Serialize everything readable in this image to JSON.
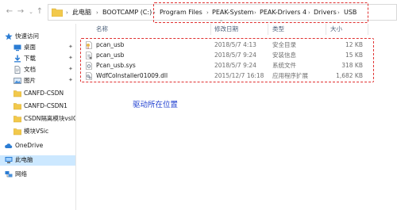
{
  "nav": {
    "back_icon": "arrow-left-icon",
    "forward_icon": "arrow-right-icon",
    "recent_icon": "chevron-down-icon",
    "up_icon": "arrow-up-icon"
  },
  "address": {
    "crumbs": [
      "此电脑",
      "BOOTCAMP (C:)",
      "Program Files",
      "PEAK-System",
      "PEAK-Drivers 4",
      "Drivers",
      "USB"
    ],
    "separator": "›"
  },
  "sidebar": {
    "items": [
      {
        "label": "快速访问",
        "icon": "star-icon",
        "pinned": false
      },
      {
        "label": "桌面",
        "icon": "desktop-icon",
        "pinned": true
      },
      {
        "label": "下载",
        "icon": "download-icon",
        "pinned": true
      },
      {
        "label": "文档",
        "icon": "document-icon",
        "pinned": true
      },
      {
        "label": "图片",
        "icon": "picture-icon",
        "pinned": true
      },
      {
        "label": "CANFD-CSDN",
        "icon": "folder-icon",
        "pinned": false
      },
      {
        "label": "CANFD-CSDN1",
        "icon": "folder-icon",
        "pinned": false
      },
      {
        "label": "CSDN隔离模块vsIC",
        "icon": "folder-icon",
        "pinned": false
      },
      {
        "label": "模块VSic",
        "icon": "folder-icon",
        "pinned": false
      },
      {
        "label": "OneDrive",
        "icon": "cloud-icon",
        "pinned": false
      },
      {
        "label": "此电脑",
        "icon": "computer-icon",
        "pinned": false,
        "selected": true
      },
      {
        "label": "网络",
        "icon": "network-icon",
        "pinned": false
      }
    ],
    "pin_glyph": "✦"
  },
  "columns": {
    "name": "名称",
    "date": "修改日期",
    "type": "类型",
    "size": "大小"
  },
  "files": [
    {
      "name": "pcan_usb",
      "date": "2018/5/7 4:13",
      "type": "安全目录",
      "size": "12 KB",
      "icon": "catalog-file-icon"
    },
    {
      "name": "pcan_usb",
      "date": "2018/5/7 9:24",
      "type": "安装信息",
      "size": "15 KB",
      "icon": "setup-info-icon"
    },
    {
      "name": "Pcan_usb.sys",
      "date": "2018/5/7 9:24",
      "type": "系统文件",
      "size": "318 KB",
      "icon": "system-file-icon"
    },
    {
      "name": "WdfCoInstaller01009.dll",
      "date": "2015/12/7 16:18",
      "type": "应用程序扩展",
      "size": "1,682 KB",
      "icon": "dll-file-icon"
    }
  ],
  "annotation": "驱动所在位置",
  "colors": {
    "highlight_red": "#e03030",
    "annotation_blue": "#1f3fd0",
    "selected_bg": "#cce8ff",
    "folder_yellow": "#f2c94c"
  }
}
